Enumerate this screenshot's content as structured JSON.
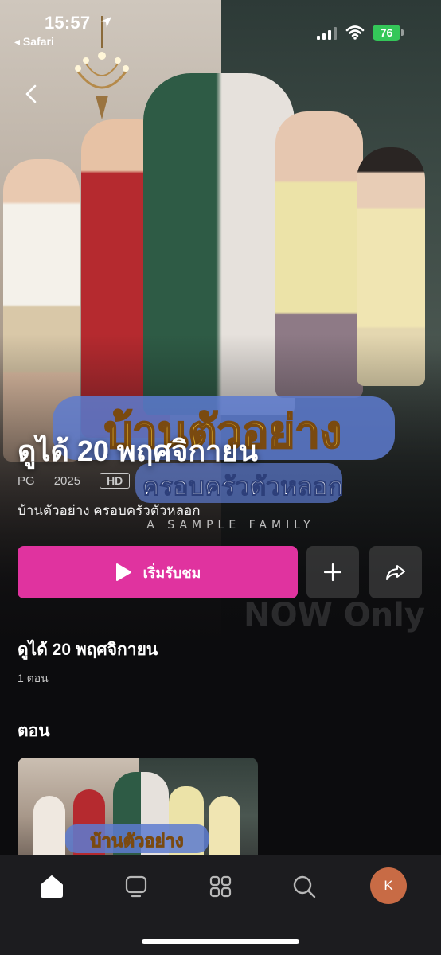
{
  "status_bar": {
    "time": "15:57",
    "back_app": "◂ Safari",
    "battery": "76"
  },
  "hero": {
    "logo_line1": "บ้านตัวอย่าง",
    "logo_line2": "ครอบครัวตัวหลอก",
    "logo_line3": "A SAMPLE FAMILY",
    "badge_text": "NOW Only"
  },
  "show": {
    "title": "ดูได้ 20 พฤศจิกายน",
    "rating": "PG",
    "year": "2025",
    "quality": "HD",
    "subtitle": "บ้านตัวอย่าง ครอบครัวตัวหลอก"
  },
  "actions": {
    "play_label": "เริ่มรับชม"
  },
  "availability": {
    "heading": "ดูได้ 20 พฤศจิกายน",
    "episode_count": "1 ตอน"
  },
  "episodes": {
    "heading": "ตอน",
    "thumb_logo": "บ้านตัวอย่าง"
  },
  "tab_bar": {
    "avatar_initial": "K"
  },
  "colors": {
    "accent": "#e0339f",
    "battery": "#34c759",
    "avatar": "#c86b45"
  }
}
